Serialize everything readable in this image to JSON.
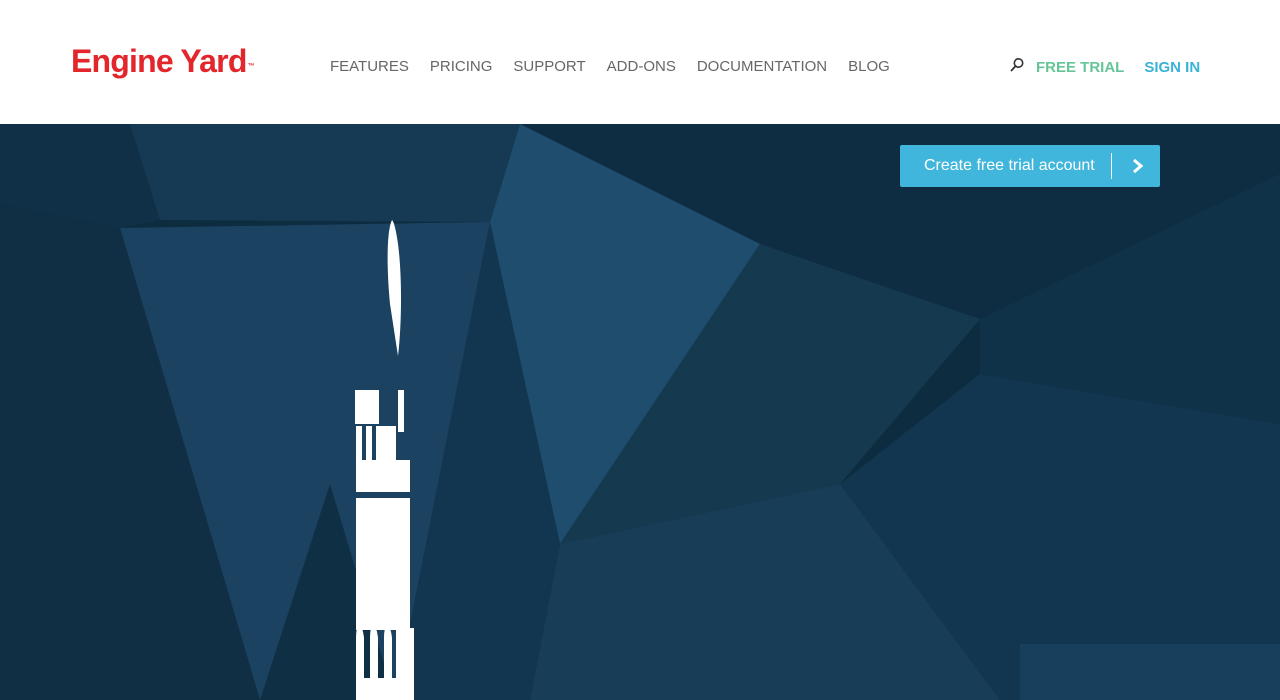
{
  "header": {
    "logo": {
      "text": "Engine Yard",
      "trademark": "™",
      "color": "#e2262b"
    },
    "nav": {
      "items": [
        {
          "label": "FEATURES"
        },
        {
          "label": "PRICING"
        },
        {
          "label": "SUPPORT"
        },
        {
          "label": "ADD-ONS"
        },
        {
          "label": "DOCUMENTATION"
        },
        {
          "label": "BLOG"
        }
      ],
      "color": "#666666"
    },
    "actions": {
      "search_icon": "search-icon",
      "free_trial_label": "FREE TRIAL",
      "free_trial_color": "#66c596",
      "sign_in_label": "SIGN IN",
      "sign_in_color": "#3ab3d7"
    }
  },
  "hero": {
    "cta": {
      "label": "Create free trial account",
      "icon": "chevron-right-icon",
      "color": "#41b6dc"
    },
    "background_color": "#0b2a3d"
  }
}
